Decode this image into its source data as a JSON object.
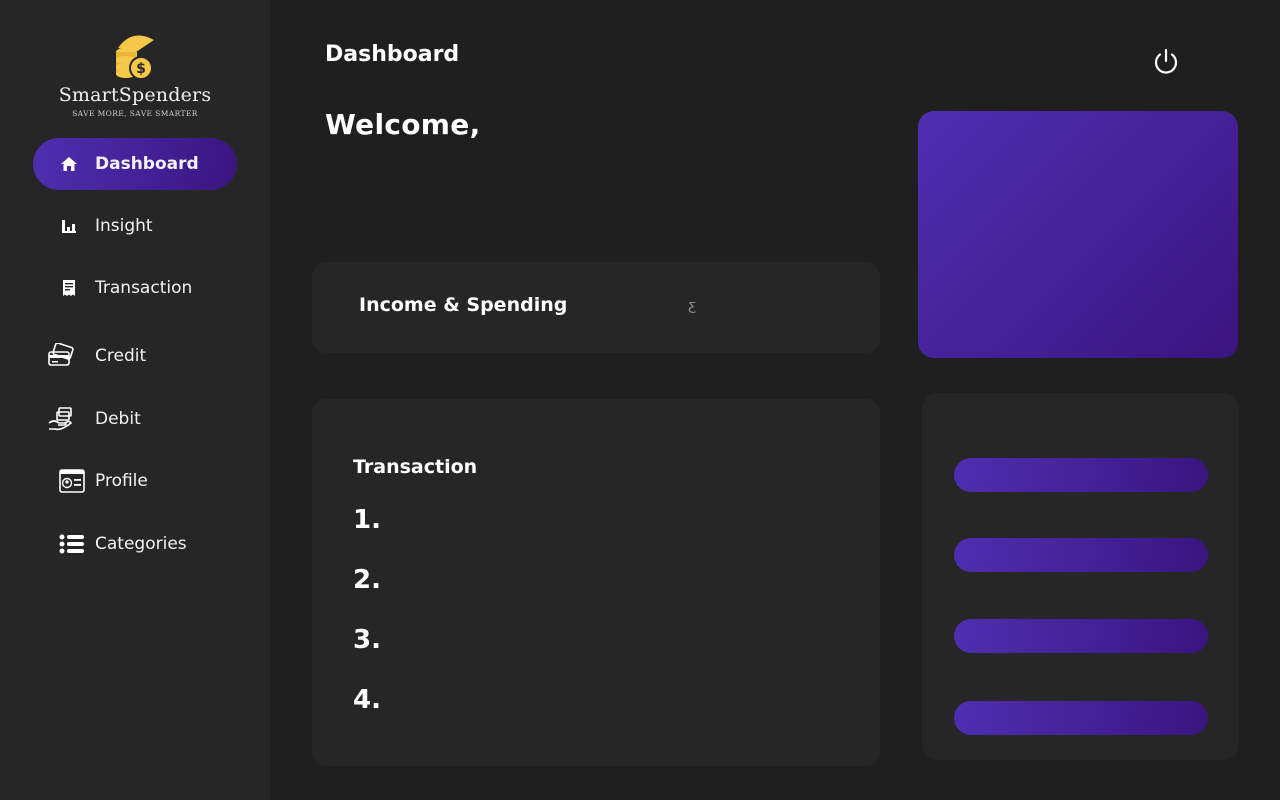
{
  "brand": {
    "name": "SmartSpenders",
    "tagline": "SAVE MORE, SAVE SMARTER",
    "accent": "#4e2fb0",
    "accent_dark": "#3a1580",
    "logo_color": "#f5c84a"
  },
  "sidebar": {
    "items": [
      {
        "label": "Dashboard",
        "icon": "home-icon",
        "active": true
      },
      {
        "label": "Insight",
        "icon": "bar-chart-icon",
        "active": false
      },
      {
        "label": "Transaction",
        "icon": "receipt-icon",
        "active": false
      },
      {
        "label": "Credit",
        "icon": "credit-card-icon",
        "active": false
      },
      {
        "label": "Debit",
        "icon": "hand-money-icon",
        "active": false
      },
      {
        "label": "Profile",
        "icon": "profile-card-icon",
        "active": false
      },
      {
        "label": "Categories",
        "icon": "list-icon",
        "active": false
      }
    ]
  },
  "header": {
    "title": "Dashboard",
    "welcome": "Welcome,",
    "power_icon": "power-icon"
  },
  "income_card": {
    "title": "Income & Spending",
    "glyph": "ƹ"
  },
  "transactions": {
    "title": "Transaction",
    "items": [
      "1.",
      "2.",
      "3.",
      "4."
    ]
  },
  "colors": {
    "background": "#1f1f1f",
    "panel": "#262626"
  }
}
